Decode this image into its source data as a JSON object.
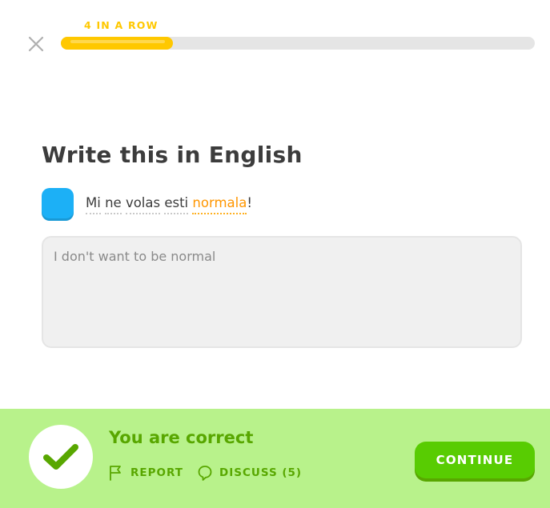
{
  "header": {
    "close_icon": "close-icon",
    "streak_label": "4 IN A ROW",
    "progress": 0.236,
    "colors": {
      "progress_fill": "#ffc800",
      "progress_track": "#e5e5e5"
    }
  },
  "challenge": {
    "title": "Write this in English",
    "speaker_icon": "speaker-icon",
    "sentence": {
      "words": [
        "Mi",
        "ne",
        "volas",
        "esti"
      ],
      "highlight": "normala",
      "punctuation": "!"
    },
    "answer_value": "I don't want to be normal"
  },
  "feedback": {
    "status_icon": "checkmark-icon",
    "title": "You are correct",
    "report_label": "REPORT",
    "discuss_label": "DISCUSS (5)",
    "continue_label": "CONTINUE",
    "colors": {
      "background": "#b8f28b",
      "text": "#58a700",
      "button": "#58cc02"
    }
  }
}
